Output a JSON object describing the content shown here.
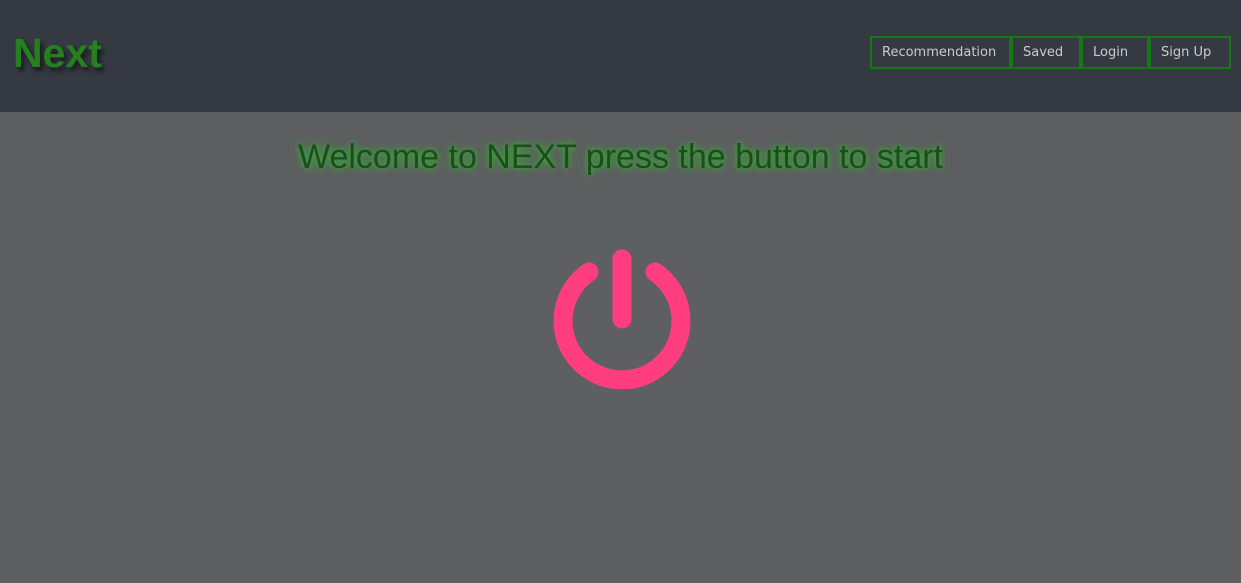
{
  "brand": {
    "title": "Next",
    "color": "#26801f"
  },
  "nav": {
    "items": [
      {
        "label": "Recommendation"
      },
      {
        "label": "Saved"
      },
      {
        "label": "Login"
      },
      {
        "label": "Sign Up"
      }
    ],
    "border_color": "#137a13"
  },
  "main": {
    "welcome_text": "Welcome to NEXT press the button to start",
    "start_button": {
      "icon": "power-icon",
      "color": "#ff3d7f"
    }
  },
  "colors": {
    "header_bg": "#353941",
    "page_bg": "#5e5f61"
  }
}
